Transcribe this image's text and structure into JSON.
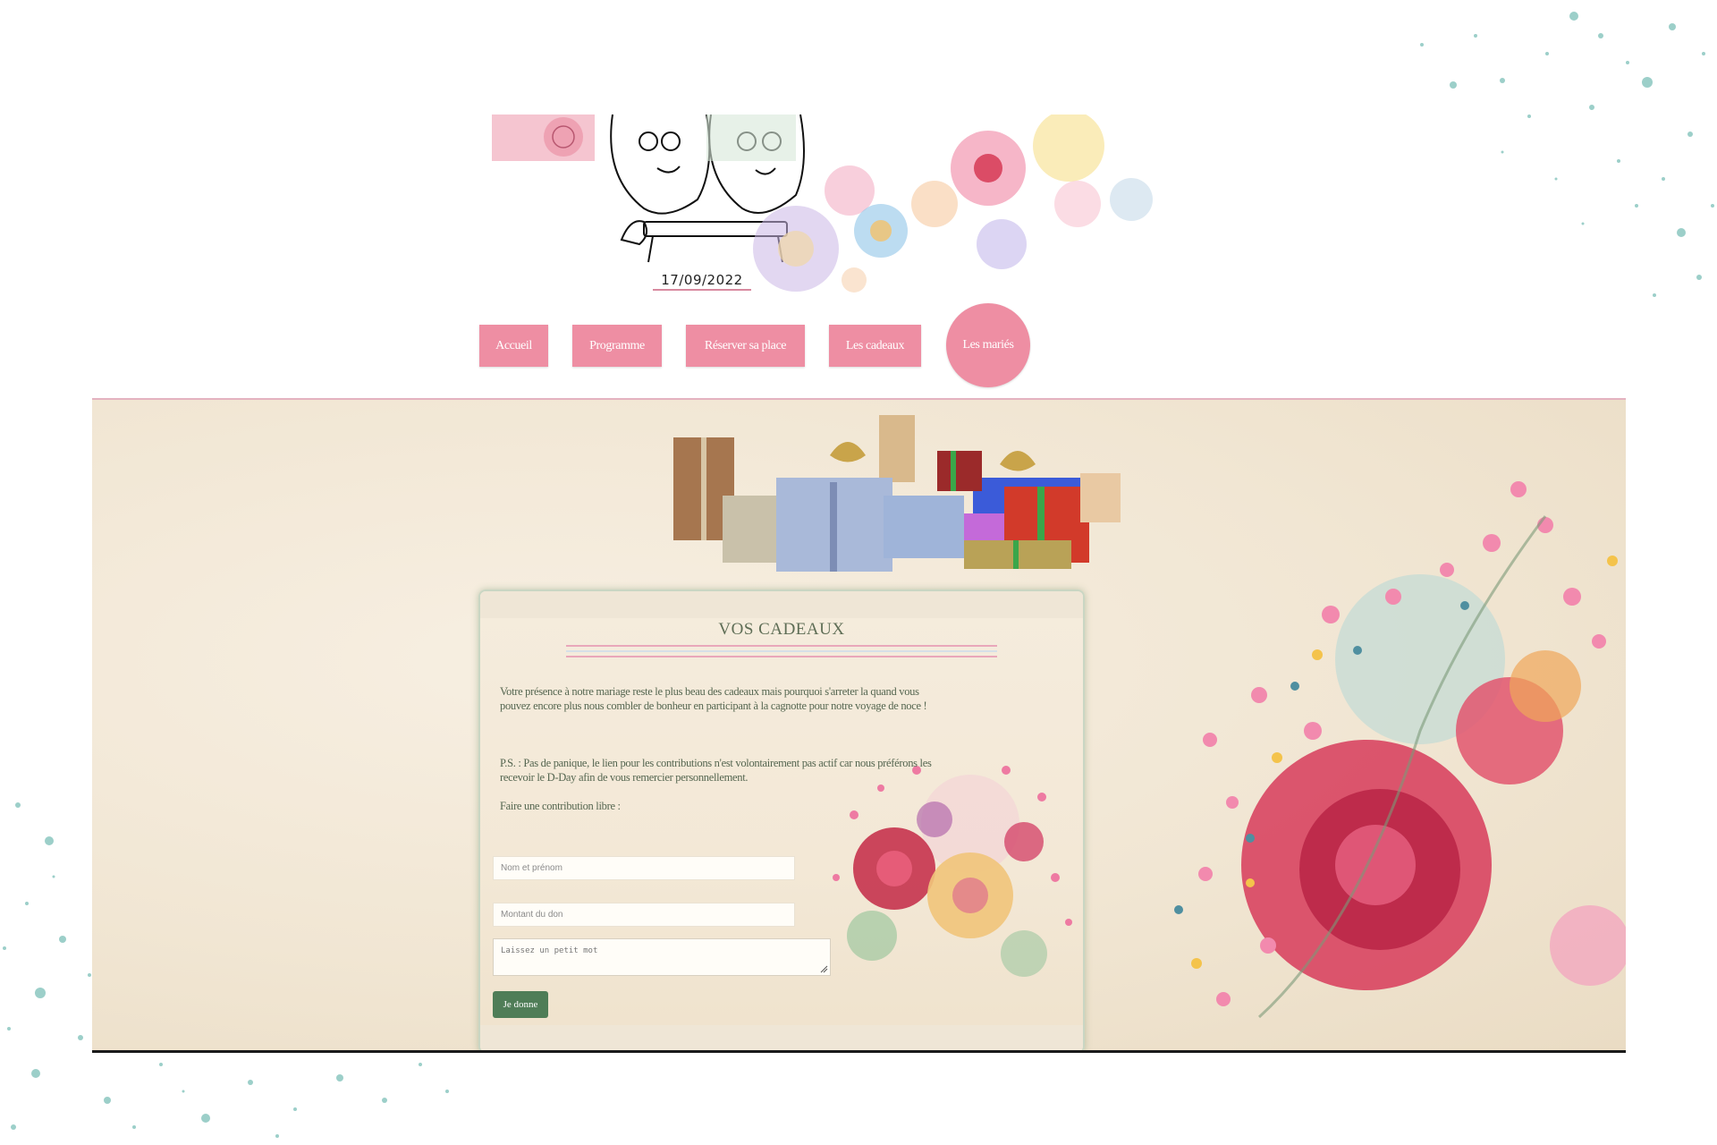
{
  "header": {
    "wedding_date": "17/09/2022"
  },
  "nav": {
    "items": [
      {
        "label": "Accueil"
      },
      {
        "label": "Programme"
      },
      {
        "label": "Réserver sa place"
      },
      {
        "label": "Les cadeaux"
      },
      {
        "label": "Les mariés"
      }
    ],
    "color": "#ee8ea3"
  },
  "gifts_section": {
    "title": "VOS CADEAUX",
    "intro": "Votre présence à notre mariage reste le plus beau des cadeaux mais pourquoi s'arreter la quand vous pouvez encore plus nous combler de bonheur en participant à la cagnotte pour notre voyage de noce !",
    "ps": "P.S. : Pas de panique, le lien pour les contributions n'est volontairement pas actif car nous préférons les recevoir le D-Day afin de vous remercier personnellement.",
    "contribution_label": "Faire une contribution libre :",
    "form": {
      "name_placeholder": "Nom et prénom",
      "amount_placeholder": "Montant du don",
      "message_placeholder": "Laissez un petit mot",
      "submit_label": "Je donne"
    },
    "accent_green": "#4f7d57"
  }
}
